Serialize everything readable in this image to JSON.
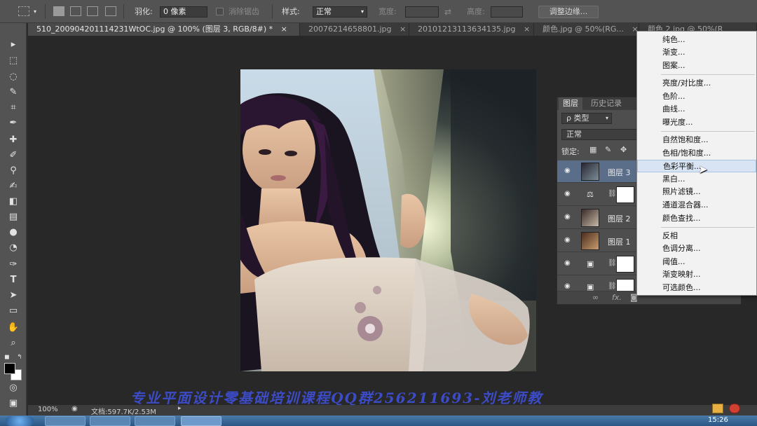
{
  "options_bar": {
    "feather_label": "羽化:",
    "feather_value": "0 像素",
    "antialias_label": "消除锯齿",
    "style_label": "样式:",
    "style_value": "正常",
    "width_label": "宽度:",
    "height_label": "高度:",
    "refine_edge_label": "调整边缘..."
  },
  "tabs": [
    {
      "label": "510_200904201114231WtOC.jpg @ 100% (图层 3, RGB/8#) *",
      "close": "×"
    },
    {
      "label": "20076214658801.jpg",
      "close": "×"
    },
    {
      "label": "20101213113634135.jpg",
      "close": "×"
    },
    {
      "label": "颜色.jpg @ 50%(RG...",
      "close": "×"
    },
    {
      "label": "颜色 2.jpg @ 50%(R",
      "close": ""
    }
  ],
  "layers_panel": {
    "tabs": [
      "图层",
      "历史记录"
    ],
    "filter_label": "ρ 类型",
    "blend_mode": "正常",
    "lock_label": "锁定:",
    "layers": [
      {
        "name": "图层 3",
        "selected": true,
        "type": "image"
      },
      {
        "name": "",
        "selected": false,
        "type": "adjustment",
        "icon": "⚖"
      },
      {
        "name": "图层 2",
        "selected": false,
        "type": "image"
      },
      {
        "name": "图层 1",
        "selected": false,
        "type": "image"
      },
      {
        "name": "",
        "selected": false,
        "type": "adjustment",
        "icon": "▣"
      },
      {
        "name": "",
        "selected": false,
        "type": "adjustment",
        "icon": "▣"
      }
    ],
    "footer_fx": "fx."
  },
  "adjustment_menu": {
    "groups": [
      [
        "纯色...",
        "渐变...",
        "图案..."
      ],
      [
        "亮度/对比度...",
        "色阶...",
        "曲线...",
        "曝光度..."
      ],
      [
        "自然饱和度...",
        "色相/饱和度...",
        "色彩平衡...",
        "黑白...",
        "照片滤镜...",
        "通道混合器...",
        "颜色查找..."
      ],
      [
        "反相",
        "色调分离...",
        "阈值...",
        "渐变映射...",
        "可选颜色..."
      ]
    ],
    "highlighted": "色彩平衡..."
  },
  "status_bar": {
    "zoom": "100%",
    "doc_info": "文档:597.7K/2.53M"
  },
  "watermark": "专业平面设计零基础培训课程QQ群256211693-刘老师教",
  "taskbar": {
    "clock": "15:26"
  },
  "colors": {
    "accent_highlight": "#d8e4f3",
    "watermark": "#3f4fd8",
    "selected_layer": "#5a6e8a"
  }
}
